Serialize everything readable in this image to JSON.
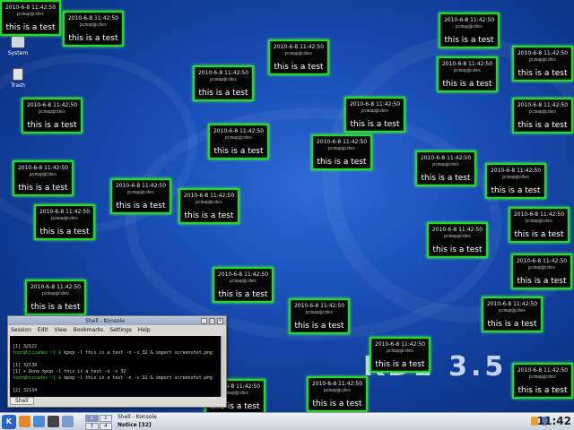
{
  "desktop": {
    "icons": [
      {
        "label": "System"
      },
      {
        "label": "Trash"
      }
    ],
    "logo_text": "KDE 3.5"
  },
  "notification": {
    "timestamp": "2010-6-8 11:42:50",
    "host": "pcmap@cdes",
    "message": "this is a test"
  },
  "konsole": {
    "title": "Shell - Konsole",
    "menu": [
      "Session",
      "Edit",
      "View",
      "Bookmarks",
      "Settings",
      "Help"
    ],
    "lines": [
      {
        "prompt": "",
        "text": ""
      },
      {
        "prompt": "",
        "text": "[1] 32122"
      },
      {
        "prompt": "toor@hiccades ~] $ ",
        "text": "kpop -l this is a test -n -s 32 & import screenshot.png"
      },
      {
        "prompt": "",
        "text": ""
      },
      {
        "prompt": "",
        "text": "[1] 32130"
      },
      {
        "prompt": "[1] + Done",
        "text": "              kpop -l this is a test -n -s 32"
      },
      {
        "prompt": "toor@hiccades ~] $ ",
        "text": "kpop -l this is a test -n -s 32 & import screenshot.png"
      },
      {
        "prompt": "",
        "text": ""
      },
      {
        "prompt": "",
        "text": "[2] 32134"
      }
    ],
    "tab_label": "Shell"
  },
  "taskbar": {
    "kmenu_label": "K",
    "pager": [
      "1",
      "2",
      "3",
      "4"
    ],
    "tasks": [
      {
        "label": "Shell - Konsole"
      },
      {
        "label": "Notice [32]"
      }
    ],
    "clock": "11:42"
  }
}
